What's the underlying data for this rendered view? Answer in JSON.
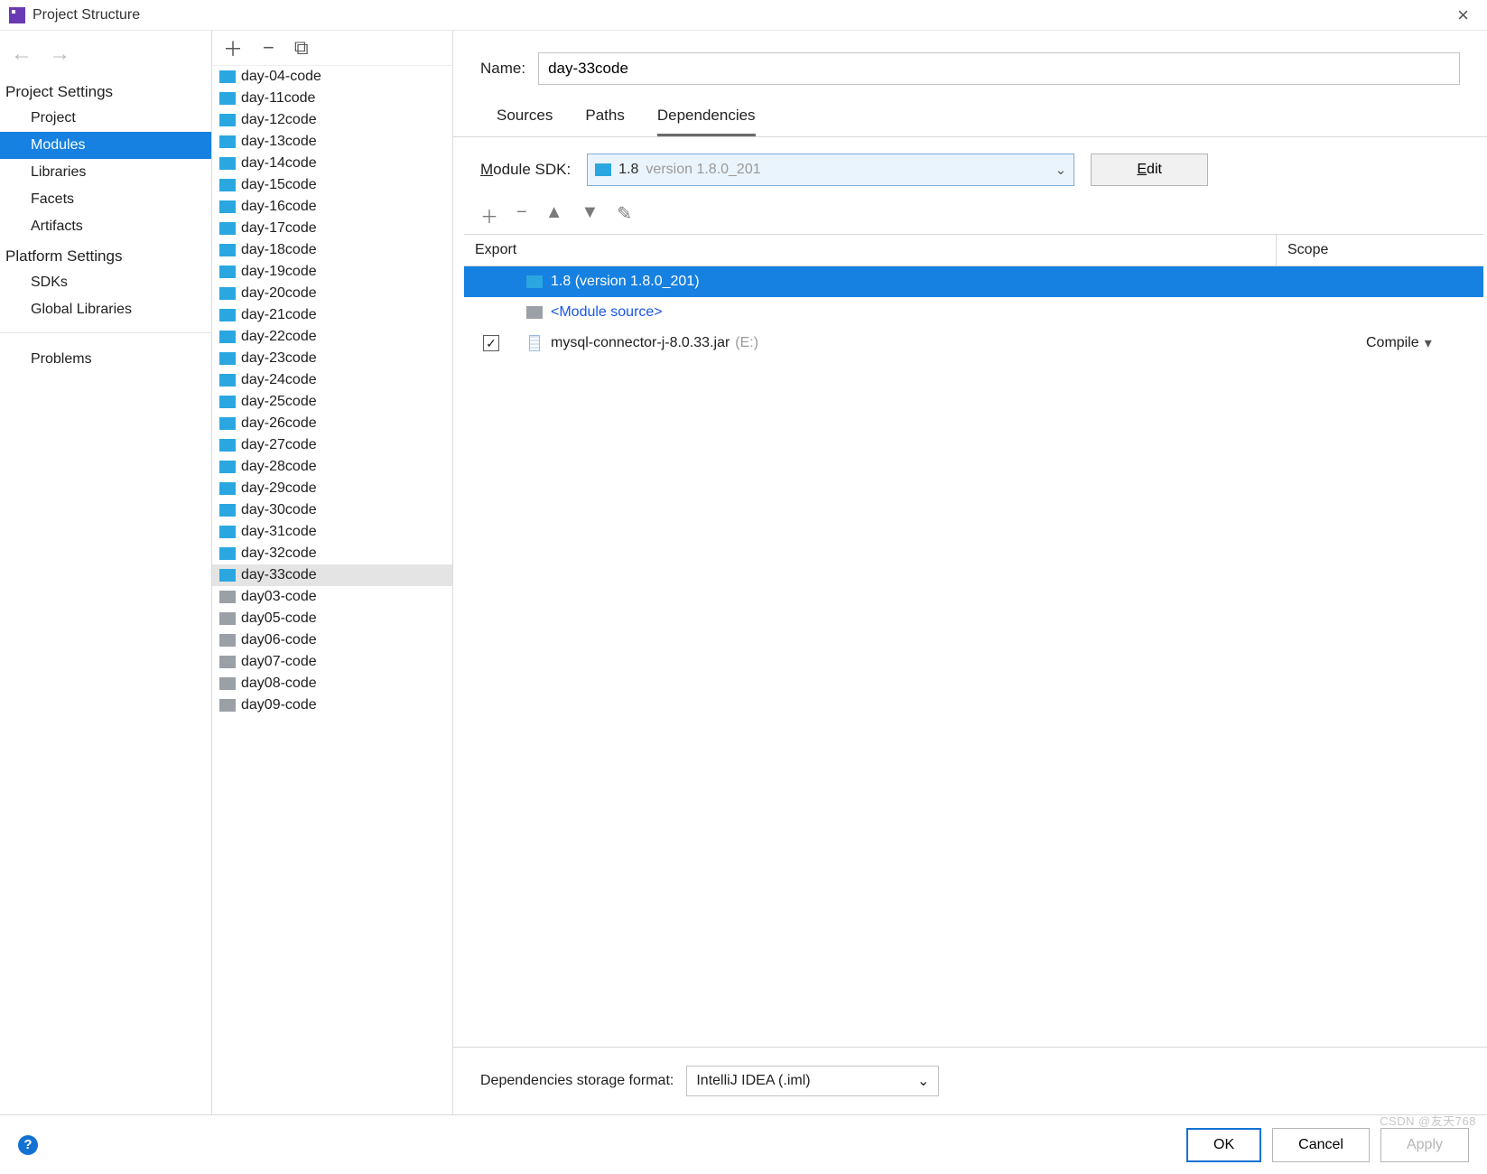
{
  "window": {
    "title": "Project Structure"
  },
  "nav": {
    "project_settings_label": "Project Settings",
    "project_items": [
      {
        "label": "Project",
        "selected": false
      },
      {
        "label": "Modules",
        "selected": true
      },
      {
        "label": "Libraries",
        "selected": false
      },
      {
        "label": "Facets",
        "selected": false
      },
      {
        "label": "Artifacts",
        "selected": false
      }
    ],
    "platform_settings_label": "Platform Settings",
    "platform_items": [
      {
        "label": "SDKs"
      },
      {
        "label": "Global Libraries"
      }
    ],
    "problems_label": "Problems"
  },
  "modules": [
    {
      "label": "day-04-code",
      "active": true
    },
    {
      "label": "day-11code",
      "active": true
    },
    {
      "label": "day-12code",
      "active": true
    },
    {
      "label": "day-13code",
      "active": true
    },
    {
      "label": "day-14code",
      "active": true
    },
    {
      "label": "day-15code",
      "active": true
    },
    {
      "label": "day-16code",
      "active": true
    },
    {
      "label": "day-17code",
      "active": true
    },
    {
      "label": "day-18code",
      "active": true
    },
    {
      "label": "day-19code",
      "active": true
    },
    {
      "label": "day-20code",
      "active": true
    },
    {
      "label": "day-21code",
      "active": true
    },
    {
      "label": "day-22code",
      "active": true
    },
    {
      "label": "day-23code",
      "active": true
    },
    {
      "label": "day-24code",
      "active": true
    },
    {
      "label": "day-25code",
      "active": true
    },
    {
      "label": "day-26code",
      "active": true
    },
    {
      "label": "day-27code",
      "active": true
    },
    {
      "label": "day-28code",
      "active": true
    },
    {
      "label": "day-29code",
      "active": true
    },
    {
      "label": "day-30code",
      "active": true
    },
    {
      "label": "day-31code",
      "active": true
    },
    {
      "label": "day-32code",
      "active": true
    },
    {
      "label": "day-33code",
      "active": true,
      "selected": true
    },
    {
      "label": "day03-code",
      "active": false
    },
    {
      "label": "day05-code",
      "active": false
    },
    {
      "label": "day06-code",
      "active": false
    },
    {
      "label": "day07-code",
      "active": false
    },
    {
      "label": "day08-code",
      "active": false
    },
    {
      "label": "day09-code",
      "active": false
    }
  ],
  "detail": {
    "name_label": "Name:",
    "name_value": "day-33code",
    "tabs": [
      {
        "label": "Sources",
        "active": false
      },
      {
        "label": "Paths",
        "active": false
      },
      {
        "label": "Dependencies",
        "active": true
      }
    ],
    "sdk_label_pre": "M",
    "sdk_label_rest": "odule SDK:",
    "sdk_main": "1.8",
    "sdk_version": "version 1.8.0_201",
    "edit_button_pre": "E",
    "edit_button_rest": "dit",
    "columns": {
      "export": "Export",
      "scope": "Scope"
    },
    "deps": [
      {
        "type": "sdk",
        "name": "1.8 (version 1.8.0_201)",
        "selected": true
      },
      {
        "type": "modsrc",
        "name": "<Module source>"
      },
      {
        "type": "jar",
        "name": "mysql-connector-j-8.0.33.jar",
        "path": "(E:)",
        "export": true,
        "scope": "Compile"
      }
    ],
    "storage_label": "Dependencies storage format:",
    "storage_value": "IntelliJ IDEA (.iml)"
  },
  "footer": {
    "ok": "OK",
    "cancel": "Cancel",
    "apply": "Apply"
  },
  "watermark": "CSDN @友天768"
}
